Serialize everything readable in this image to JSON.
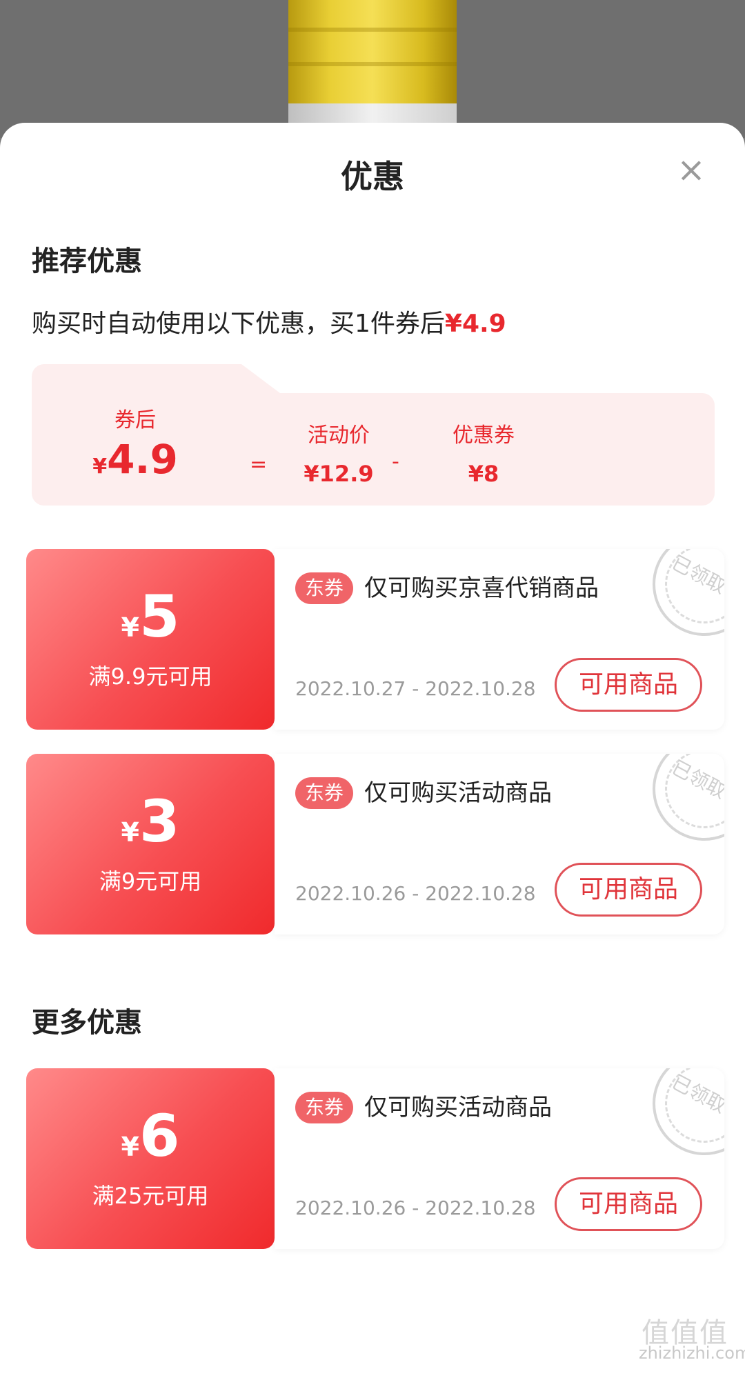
{
  "sheet": {
    "title": "优惠",
    "close": "×"
  },
  "recommended": {
    "title": "推荐优惠",
    "desc_prefix": "购买时自动使用以下优惠，买1件券后",
    "desc_price": "¥4.9",
    "summary": {
      "after_label": "券后",
      "after_yen": "¥",
      "after_value": "4.9",
      "eq": "=",
      "activity_label": "活动价",
      "activity_value": "¥12.9",
      "minus": "-",
      "coupon_label": "优惠券",
      "coupon_value": "¥8"
    }
  },
  "coupons": [
    {
      "yen": "¥",
      "amount": "5",
      "threshold": "满9.9元可用",
      "badge": "东券",
      "title": "仅可购买京喜代销商品",
      "date": "2022.10.27 - 2022.10.28",
      "button": "可用商品",
      "stamp": "已领取"
    },
    {
      "yen": "¥",
      "amount": "3",
      "threshold": "满9元可用",
      "badge": "东券",
      "title": "仅可购买活动商品",
      "date": "2022.10.26 - 2022.10.28",
      "button": "可用商品",
      "stamp": "已领取"
    }
  ],
  "more": {
    "title": "更多优惠",
    "coupons": [
      {
        "yen": "¥",
        "amount": "6",
        "threshold": "满25元可用",
        "badge": "东券",
        "title": "仅可购买活动商品",
        "date": "2022.10.26 - 2022.10.28",
        "button": "可用商品",
        "stamp": "已领取"
      }
    ]
  },
  "watermark": {
    "logo": "值值值",
    "site": "zhizhizhi.com"
  },
  "colors": {
    "accent_red": "#e8282e",
    "summary_bg": "#fdeeee",
    "coupon_gradient_start": "#ff8a8a",
    "coupon_gradient_end": "#f02a2c"
  }
}
